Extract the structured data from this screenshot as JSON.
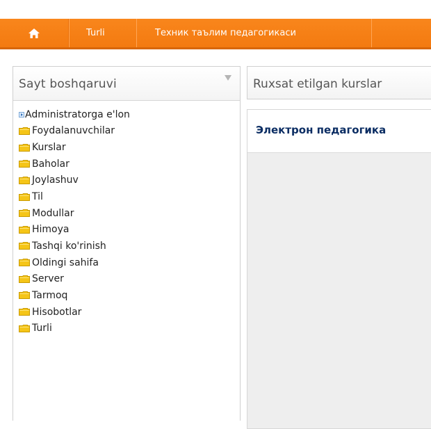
{
  "nav": {
    "home_icon": "home-icon",
    "items": [
      "Turli",
      "Техник таълим педагогикаси"
    ]
  },
  "sidebar": {
    "title": "Sayt boshqaruvi",
    "toggle_icon": "triangle-down-icon",
    "items": [
      {
        "label": "Administratorga e'lon",
        "icon": "document-icon"
      },
      {
        "label": "Foydalanuvchilar",
        "icon": "folder-icon"
      },
      {
        "label": "Kurslar",
        "icon": "folder-icon"
      },
      {
        "label": "Baholar",
        "icon": "folder-icon"
      },
      {
        "label": "Joylashuv",
        "icon": "folder-icon"
      },
      {
        "label": "Til",
        "icon": "folder-icon"
      },
      {
        "label": "Modullar",
        "icon": "folder-icon"
      },
      {
        "label": "Himoya",
        "icon": "folder-icon"
      },
      {
        "label": "Tashqi ko'rinish",
        "icon": "folder-icon"
      },
      {
        "label": "Oldingi sahifa",
        "icon": "folder-icon"
      },
      {
        "label": "Server",
        "icon": "folder-icon"
      },
      {
        "label": "Tarmoq",
        "icon": "folder-icon"
      },
      {
        "label": "Hisobotlar",
        "icon": "folder-icon"
      },
      {
        "label": "Turli",
        "icon": "folder-icon"
      }
    ]
  },
  "main": {
    "tab_label": "Ruxsat etilgan kurslar",
    "course_title": "Электрон педагогика"
  },
  "colors": {
    "nav_orange": "#f37a10",
    "folder_yellow": "#f5c518",
    "course_title": "#0b2d63"
  }
}
